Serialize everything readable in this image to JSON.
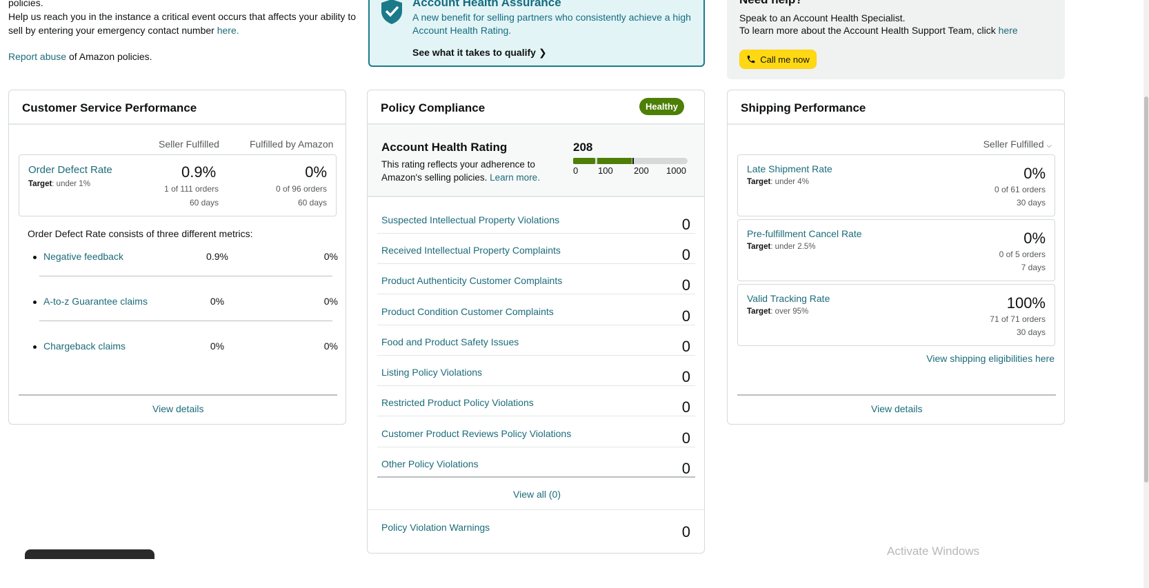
{
  "top": {
    "line0": "policies.",
    "emergency_text": "Help us reach you in the instance a critical event occurs that affects your ability to sell by entering your emergency contact number ",
    "emergency_link": "here.",
    "report_link": "Report abuse",
    "report_text": " of Amazon policies."
  },
  "aha": {
    "title": "Account Health Assurance",
    "desc": "A new benefit for selling partners who consistently achieve a high Account Health Rating.",
    "cta": "See what it takes to qualify",
    "icon": "shield-check-icon"
  },
  "help": {
    "title": "Need help?",
    "line1": "Speak to an Account Health Specialist.",
    "line2_text": "To learn more about the Account Health Support Team, click ",
    "line2_link": "here",
    "call_button": "Call me now",
    "icon": "phone-icon"
  },
  "csp": {
    "title": "Customer Service Performance",
    "col_seller": "Seller Fulfilled",
    "col_fba": "Fulfilled by Amazon",
    "odr": {
      "name": "Order Defect Rate",
      "target_label": "Target",
      "target_value": ": under 1%",
      "seller_pct": "0.9%",
      "seller_orders": "1 of 111 orders",
      "seller_days": "60 days",
      "fba_pct": "0%",
      "fba_orders": "0 of 96 orders",
      "fba_days": "60 days"
    },
    "consists": "Order Defect Rate consists of three different metrics:",
    "metrics": [
      {
        "name": "Negative feedback",
        "seller": "0.9%",
        "fba": "0%"
      },
      {
        "name": "A-to-z Guarantee claims",
        "seller": "0%",
        "fba": "0%"
      },
      {
        "name": "Chargeback claims",
        "seller": "0%",
        "fba": "0%"
      }
    ],
    "view_details": "View details"
  },
  "pc": {
    "title": "Policy Compliance",
    "badge": "Healthy",
    "ahr_title": "Account Health Rating",
    "ahr_desc": "This rating reflects your adherence to Amazon's selling policies. ",
    "ahr_learn": "Learn more.",
    "score": "208",
    "ticks": [
      "0",
      "100",
      "200",
      "1000"
    ],
    "rows": [
      {
        "name": "Suspected Intellectual Property Violations",
        "value": "0"
      },
      {
        "name": "Received Intellectual Property Complaints",
        "value": "0"
      },
      {
        "name": "Product Authenticity Customer Complaints",
        "value": "0"
      },
      {
        "name": "Product Condition Customer Complaints",
        "value": "0"
      },
      {
        "name": "Food and Product Safety Issues",
        "value": "0"
      },
      {
        "name": "Listing Policy Violations",
        "value": "0"
      },
      {
        "name": "Restricted Product Policy Violations",
        "value": "0"
      },
      {
        "name": "Customer Product Reviews Policy Violations",
        "value": "0"
      },
      {
        "name": "Other Policy Violations",
        "value": "0"
      }
    ],
    "view_all": "View all (0)",
    "warnings_name": "Policy Violation Warnings",
    "warnings_value": "0",
    "colors": {
      "good": "#4d7e06",
      "empty": "#d5d9d9"
    }
  },
  "sp": {
    "title": "Shipping Performance",
    "dropdown": "Seller Fulfilled",
    "metrics": [
      {
        "name": "Late Shipment Rate",
        "target_label": "Target",
        "target_value": ": under 4%",
        "pct": "0%",
        "orders": "0 of 61 orders",
        "days": "30 days"
      },
      {
        "name": "Pre-fulfillment Cancel Rate",
        "target_label": "Target",
        "target_value": ": under 2.5%",
        "pct": "0%",
        "orders": "0 of 5 orders",
        "days": "7 days"
      },
      {
        "name": "Valid Tracking Rate",
        "target_label": "Target",
        "target_value": ": over 95%",
        "pct": "100%",
        "orders": "71 of 71 orders",
        "days": "30 days"
      }
    ],
    "eligibility": "View shipping eligibilities here",
    "view_details": "View details"
  },
  "watermark": "Activate Windows"
}
